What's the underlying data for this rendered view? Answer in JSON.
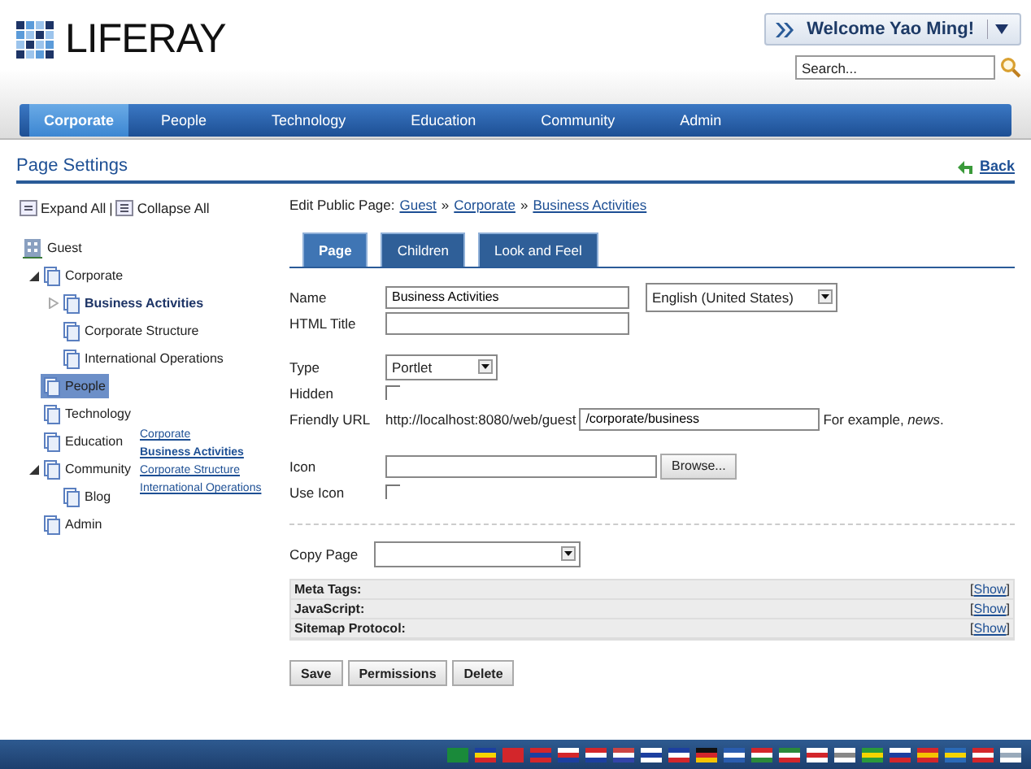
{
  "header": {
    "logo": "LIFERAY",
    "welcome": "Welcome Yao Ming!",
    "search": {
      "placeholder": "Search..."
    }
  },
  "nav": [
    {
      "label": "Corporate",
      "selected": true
    },
    {
      "label": "People",
      "selected": false
    },
    {
      "label": "Technology",
      "selected": false
    },
    {
      "label": "Education",
      "selected": false
    },
    {
      "label": "Community",
      "selected": false
    },
    {
      "label": "Admin",
      "selected": false
    }
  ],
  "portlet": {
    "title": "Page Settings",
    "back": "Back"
  },
  "tree_toolbar": {
    "expand": "Expand All",
    "separator": "|",
    "collapse": "Collapse All"
  },
  "tree": {
    "root": "Guest",
    "children": [
      {
        "label": "Corporate",
        "expanded": true,
        "selected": false,
        "children": [
          {
            "label": "Business Activities",
            "selected": true,
            "expanded": false
          },
          {
            "label": "Corporate Structure",
            "selected": false
          },
          {
            "label": "International Operations",
            "selected": false
          }
        ]
      },
      {
        "label": "People",
        "selected": false,
        "dragging": true
      },
      {
        "label": "Technology",
        "selected": false
      },
      {
        "label": "Education",
        "selected": false
      },
      {
        "label": "Community",
        "expanded": true,
        "selected": false,
        "children": [
          {
            "label": "Blog",
            "selected": false
          }
        ]
      },
      {
        "label": "Admin",
        "selected": false
      }
    ]
  },
  "drag_preview": [
    {
      "label": "Corporate",
      "bold": false
    },
    {
      "label": "Business Activities",
      "bold": true
    },
    {
      "label": "Corporate Structure",
      "bold": false
    },
    {
      "label": "International Operations",
      "bold": false
    }
  ],
  "breadcrumb": {
    "prefix": "Edit Public Page:",
    "links": [
      "Guest",
      "Corporate",
      "Business Activities"
    ],
    "separator": "»"
  },
  "tabs": [
    {
      "label": "Page",
      "selected": true
    },
    {
      "label": "Children",
      "selected": false
    },
    {
      "label": "Look and Feel",
      "selected": false
    }
  ],
  "form": {
    "name_label": "Name",
    "name_value": "Business Activities",
    "language": "English (United States)",
    "html_title_label": "HTML Title",
    "type_label": "Type",
    "type_value": "Portlet",
    "hidden_label": "Hidden",
    "hidden": false,
    "friendly_url_label": "Friendly URL",
    "url_prefix": "http://localhost:8080/web/guest",
    "url_value": "/corporate/business",
    "url_hint": "For example, *news*.",
    "icon_label": "Icon",
    "browse": "Browse...",
    "use_icon_label": "Use Icon",
    "use_icon": false,
    "copy_page_label": "Copy Page"
  },
  "sections": [
    {
      "label": "Meta Tags:",
      "open": "[",
      "action": "Show",
      "close": "]"
    },
    {
      "label": "JavaScript:",
      "open": "[",
      "action": "Show",
      "close": "]"
    },
    {
      "label": "Sitemap Protocol:",
      "open": "[",
      "action": "Show",
      "close": "]"
    }
  ],
  "buttons": [
    "Save",
    "Permissions",
    "Delete"
  ]
}
